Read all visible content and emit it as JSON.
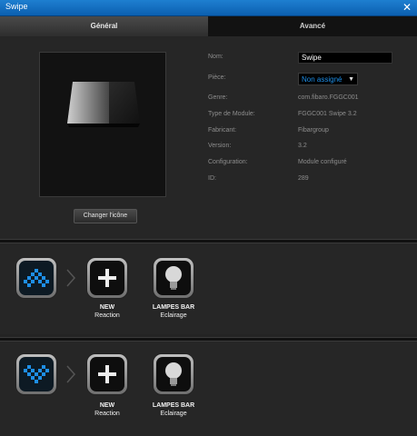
{
  "window": {
    "title": "Swipe"
  },
  "tabs": [
    {
      "label": "Général",
      "active": true
    },
    {
      "label": "Avancé",
      "active": false
    }
  ],
  "general": {
    "change_icon_label": "Changer l'icône",
    "fields": {
      "name": {
        "label": "Nom:",
        "value": "Swipe"
      },
      "room": {
        "label": "Pièce:",
        "value": "Non assigné"
      }
    },
    "info": [
      {
        "label": "Genre:",
        "value": "com.fibaro.FGGC001"
      },
      {
        "label": "Type de Module:",
        "value": "FGGC001 Swipe 3.2"
      },
      {
        "label": "Fabricant:",
        "value": "Fibargroup"
      },
      {
        "label": "Version:",
        "value": "3.2"
      },
      {
        "label": "Configuration:",
        "value": "Module configuré"
      },
      {
        "label": "ID:",
        "value": "289"
      }
    ]
  },
  "scenes": [
    {
      "gesture": "swipe-up",
      "new_reaction": {
        "title": "NEW",
        "subtitle": "Reaction"
      },
      "action": {
        "title": "LAMPES BAR",
        "subtitle": "Eclairage"
      }
    },
    {
      "gesture": "swipe-down",
      "new_reaction": {
        "title": "NEW",
        "subtitle": "Reaction"
      },
      "action": {
        "title": "LAMPES BAR",
        "subtitle": "Eclairage"
      }
    }
  ],
  "colors": {
    "accent_blue": "#1e8fe8",
    "titlebar": "#0b5fb0"
  },
  "icons": {
    "close": "close-icon",
    "gesture_up": "gesture-up-icon",
    "gesture_down": "gesture-down-icon",
    "add": "plus-icon",
    "bulb": "light-bulb-icon",
    "arrow": "chevron-right-icon"
  }
}
